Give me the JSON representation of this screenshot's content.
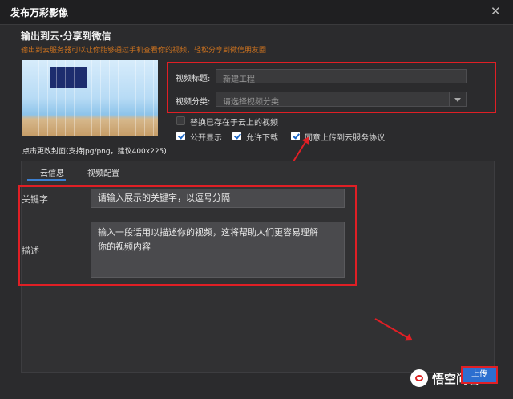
{
  "window": {
    "title": "发布万彩影像",
    "close_glyph": "✕"
  },
  "section_title": "输出到云·分享到微信",
  "notice": "输出到云服务器可以让你能够通过手机查看你的视频，轻松分享到微信朋友圈",
  "cover": {
    "tip": "点击更改封面(支持jpg/png，建议400x225)"
  },
  "form": {
    "title_label": "视频标题:",
    "title_value": "新建工程",
    "category_label": "视频分类:",
    "category_value": "请选择视频分类"
  },
  "checkboxes": {
    "replace": {
      "label": "替换已存在于云上的视频",
      "checked": false
    },
    "public": {
      "label": "公开显示",
      "checked": true
    },
    "download": {
      "label": "允许下载",
      "checked": true
    },
    "agree": {
      "label": "同意上传到云服务协议",
      "checked": true
    }
  },
  "tabs": [
    {
      "label": "云信息",
      "active": true
    },
    {
      "label": "视频配置",
      "active": false
    }
  ],
  "cloud_info": {
    "keywords_label": "关键字",
    "keywords_value": "请输入展示的关键字，以逗号分隔",
    "description_label": "描述",
    "description_line1": "输入一段话用以描述你的视频，这将帮助人们更容易理解",
    "description_line2": "你的视频内容"
  },
  "upload_button": "上传",
  "watermark": "悟空问答",
  "colors": {
    "accent": "#2d6fd0",
    "highlight": "#e01f25",
    "notice": "#c8701f"
  }
}
